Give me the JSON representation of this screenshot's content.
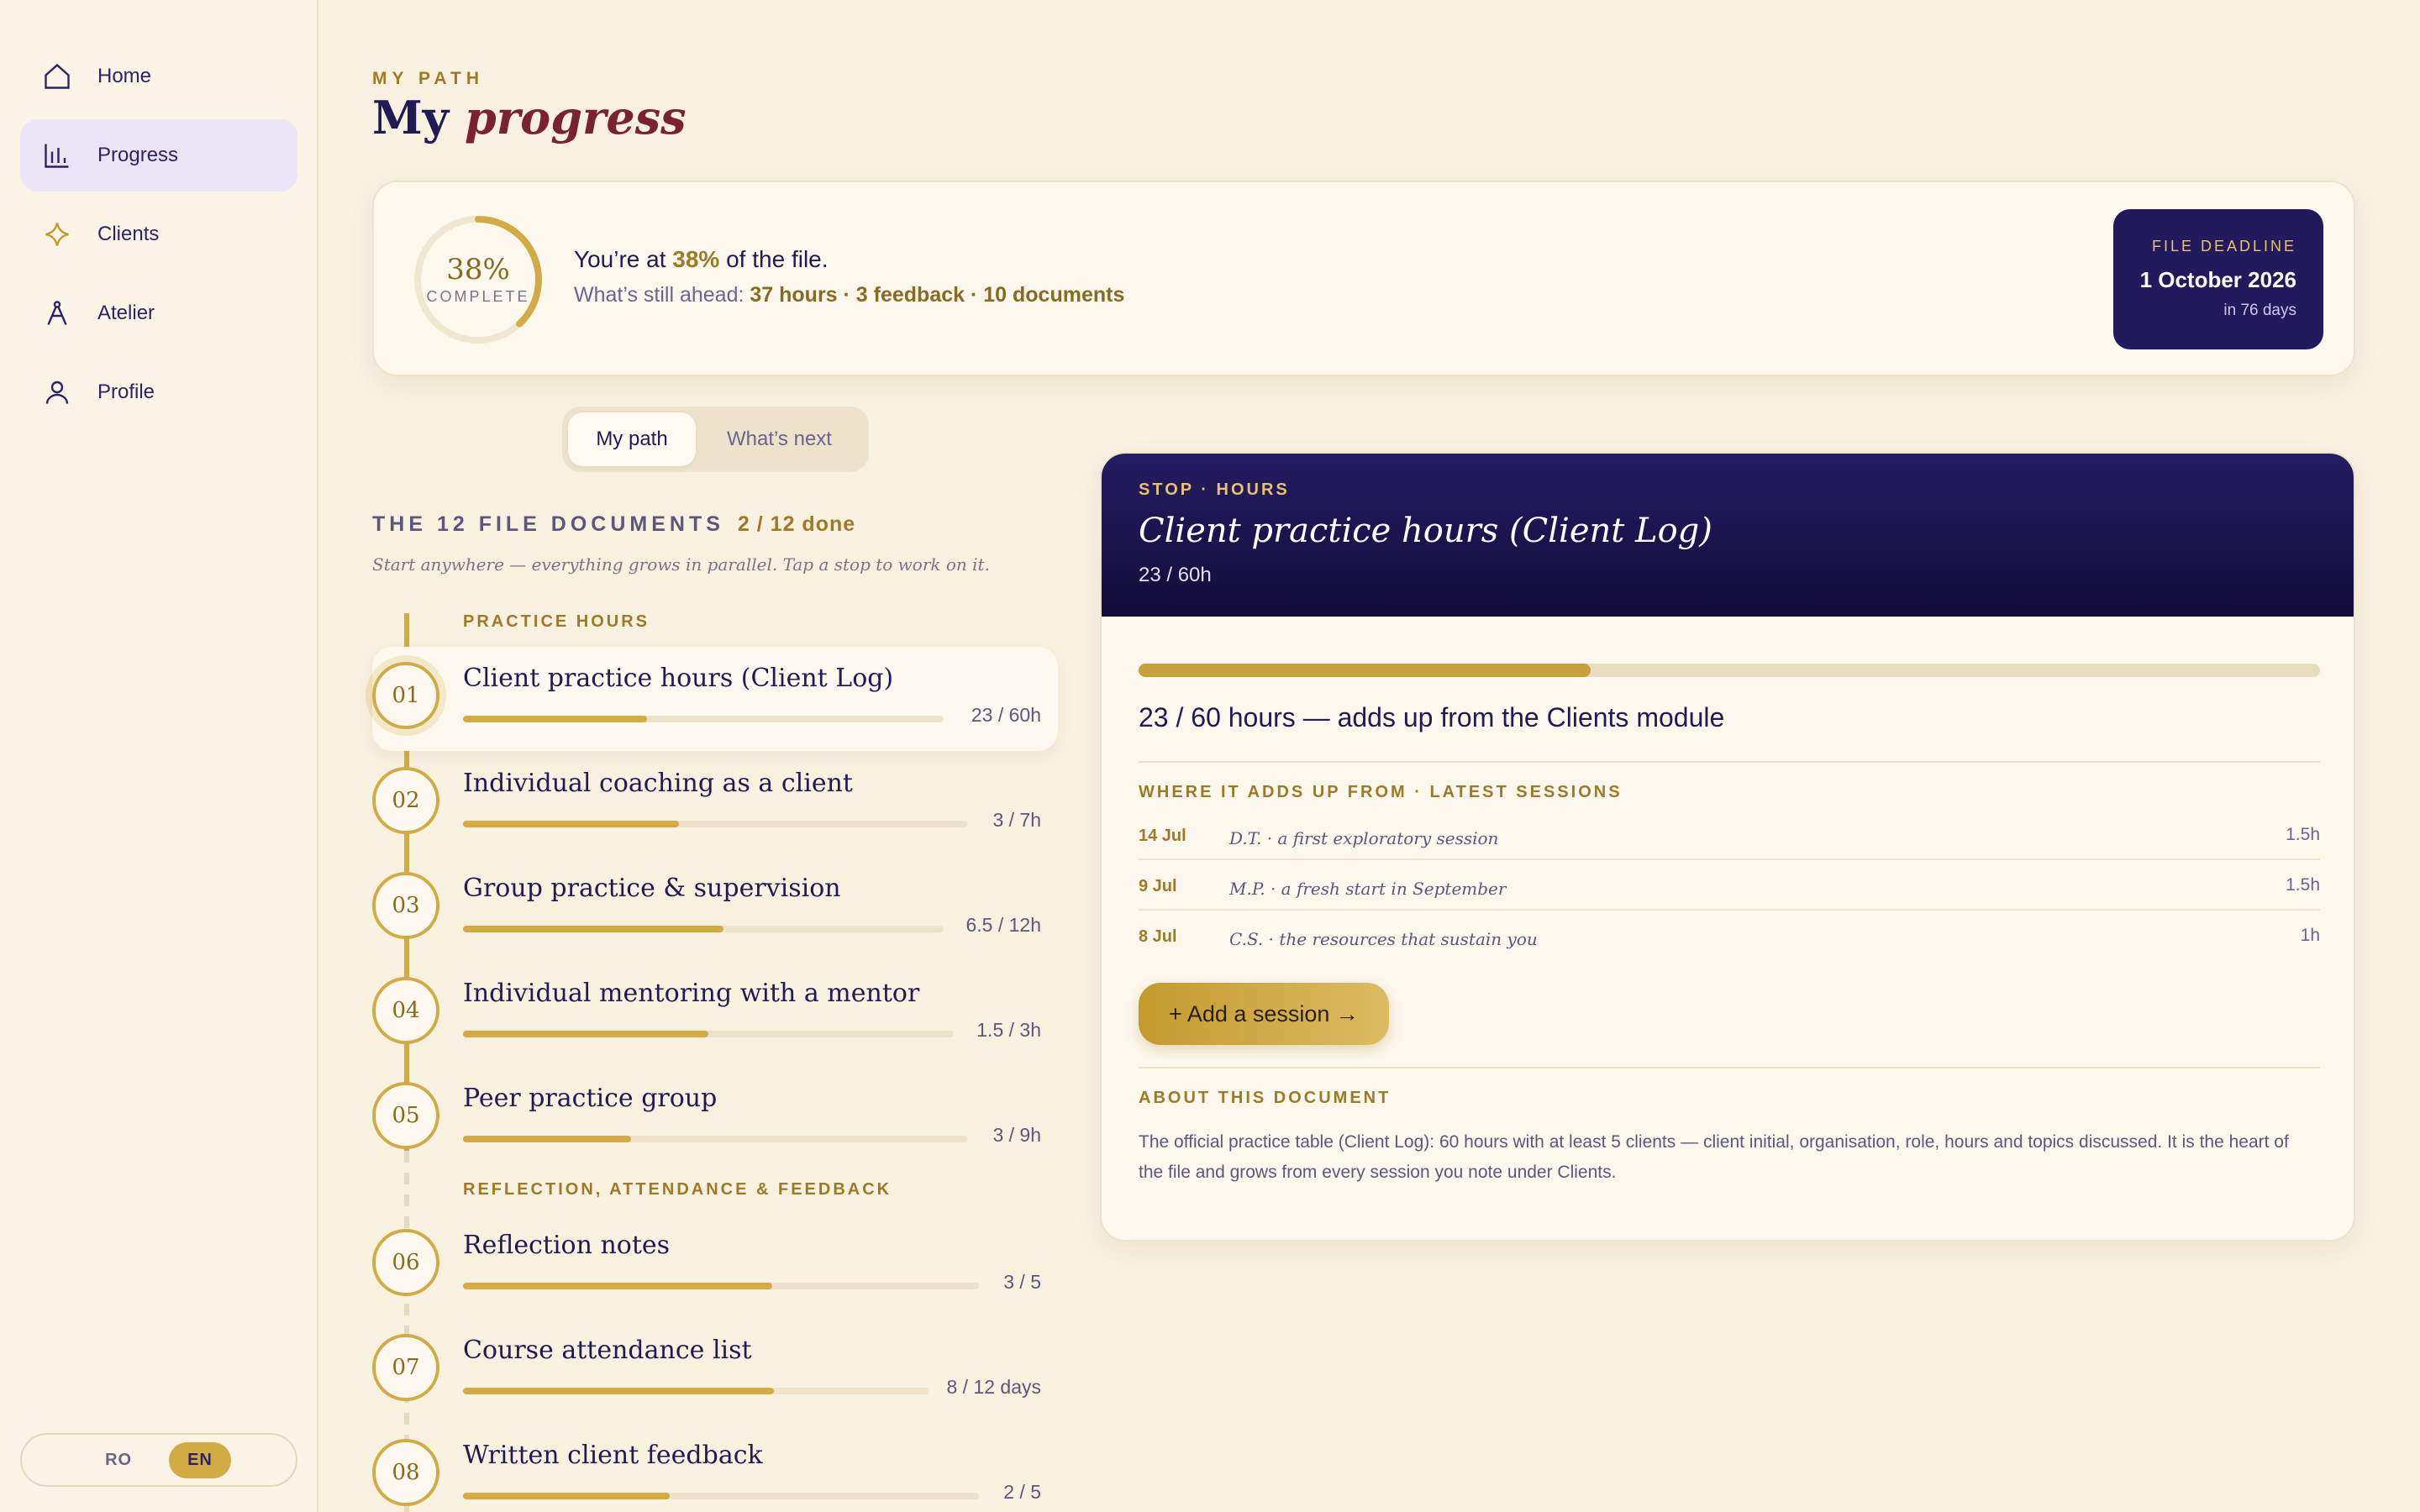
{
  "nav": {
    "items": [
      {
        "label": "Home",
        "icon": "home-icon"
      },
      {
        "label": "Progress",
        "icon": "bar-chart-icon"
      },
      {
        "label": "Clients",
        "icon": "sparkle-icon"
      },
      {
        "label": "Atelier",
        "icon": "compass-icon"
      },
      {
        "label": "Profile",
        "icon": "user-icon"
      }
    ],
    "active": "Progress"
  },
  "lang": {
    "ro": "RO",
    "en": "EN",
    "active": "EN"
  },
  "header": {
    "eyebrow": "MY PATH",
    "title_a": "My",
    "title_b": "progress"
  },
  "summary": {
    "percent": 38,
    "percent_label": "38%",
    "complete_label": "COMPLETE",
    "line1_pre": "You’re at",
    "line1_pct": "38%",
    "line1_post": "of the file.",
    "line2_pre": "What’s still ahead:",
    "line2_val": "37 hours · 3 feedback · 10 documents",
    "deadline_label": "FILE DEADLINE",
    "deadline_date": "1 October 2026",
    "deadline_rel": "in 76 days"
  },
  "tabs": [
    "My path",
    "What’s next"
  ],
  "documents": {
    "heading": "THE 12 FILE DOCUMENTS",
    "done": "2 / 12 done",
    "subtitle": "Start anywhere — everything grows in parallel. Tap a stop to work on it.",
    "group1": "PRACTICE HOURS",
    "group2": "REFLECTION, ATTENDANCE & FEEDBACK",
    "stops": [
      {
        "num": "01",
        "name": "Client practice hours (Client Log)",
        "value": "23 / 60h",
        "progress": 0.383
      },
      {
        "num": "02",
        "name": "Individual coaching as a client",
        "value": "3 / 7h",
        "progress": 0.429
      },
      {
        "num": "03",
        "name": "Group practice & supervision",
        "value": "6.5 / 12h",
        "progress": 0.542
      },
      {
        "num": "04",
        "name": "Individual mentoring with a mentor",
        "value": "1.5 / 3h",
        "progress": 0.5
      },
      {
        "num": "05",
        "name": "Peer practice group",
        "value": "3 / 9h",
        "progress": 0.333
      },
      {
        "num": "06",
        "name": "Reflection notes",
        "value": "3 / 5",
        "progress": 0.6
      },
      {
        "num": "07",
        "name": "Course attendance list",
        "value": "8 / 12 days",
        "progress": 0.667
      },
      {
        "num": "08",
        "name": "Written client feedback",
        "value": "2 / 5",
        "progress": 0.4
      }
    ]
  },
  "detail": {
    "eyebrow": "STOP · HOURS",
    "title": "Client practice hours (Client Log)",
    "sub": "23 / 60h",
    "progress": 0.383,
    "summary": "23 / 60 hours — adds up from the Clients module",
    "sessions_heading": "WHERE IT ADDS UP FROM · LATEST SESSIONS",
    "sessions": [
      {
        "date": "14 Jul",
        "who": "D.T. · a first exploratory session",
        "hours": "1.5h"
      },
      {
        "date": "9 Jul",
        "who": "M.P. · a fresh start in September",
        "hours": "1.5h"
      },
      {
        "date": "8 Jul",
        "who": "C.S. · the resources that sustain you",
        "hours": "1h"
      }
    ],
    "add_button": "+ Add a session →",
    "about_heading": "ABOUT THIS DOCUMENT",
    "about_text": "The official practice table (Client Log): 60 hours with at least 5 clients — client initial, organisation, role, hours and topics discussed. It is the heart of the file and grows from every session you note under Clients."
  },
  "colors": {
    "accent": "#d2ab45",
    "ink": "#201a55",
    "deep": "#231a5e",
    "wine": "#7a2230"
  }
}
